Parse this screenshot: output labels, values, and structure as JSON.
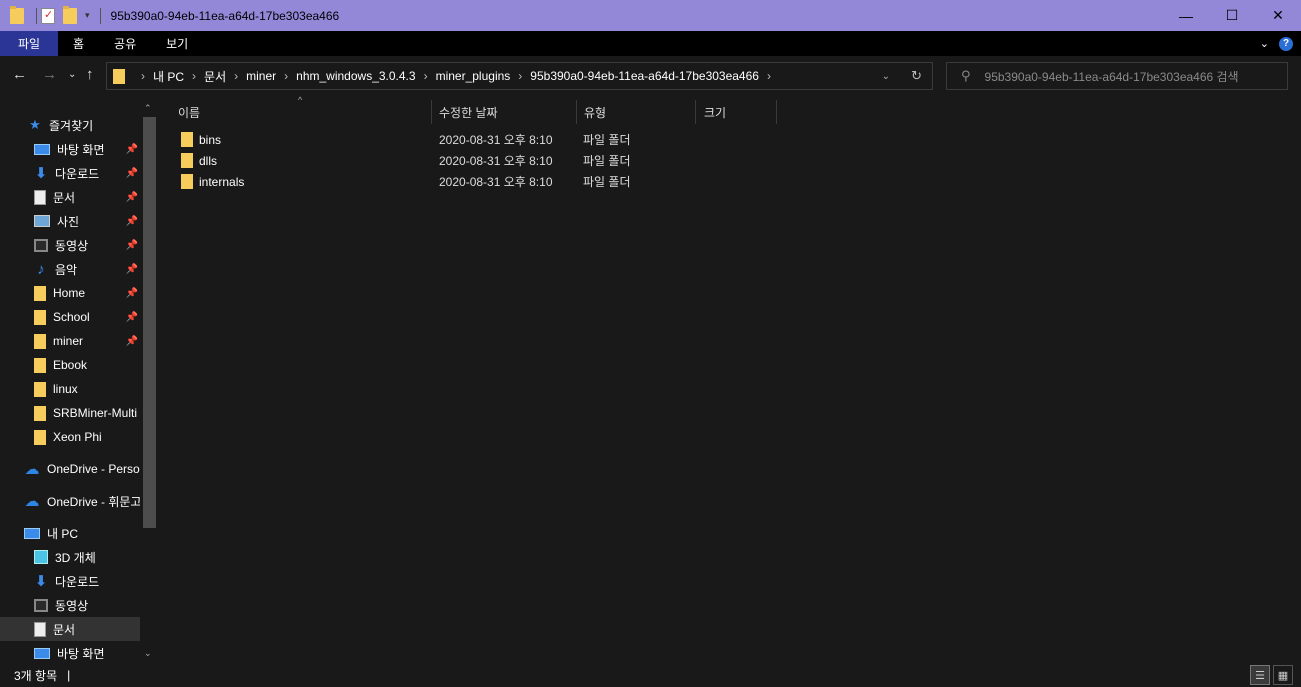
{
  "window": {
    "title": "95b390a0-94eb-11ea-a64d-17be303ea466",
    "minimize": "—",
    "maximize": "☐",
    "close": "✕"
  },
  "ribbon": {
    "tabs": [
      "파일",
      "홈",
      "공유",
      "보기"
    ],
    "expand_icon": "chevron-down-icon",
    "help": "?"
  },
  "address": {
    "crumbs": [
      "내 PC",
      "문서",
      "miner",
      "nhm_windows_3.0.4.3",
      "miner_plugins",
      "95b390a0-94eb-11ea-a64d-17be303ea466"
    ],
    "search_placeholder": "95b390a0-94eb-11ea-a64d-17be303ea466 검색"
  },
  "nav": {
    "quick_access": "즐겨찾기",
    "items": [
      {
        "label": "바탕 화면",
        "icon": "desktop-icon",
        "pinned": true
      },
      {
        "label": "다운로드",
        "icon": "download-icon",
        "pinned": true
      },
      {
        "label": "문서",
        "icon": "document-icon",
        "pinned": true
      },
      {
        "label": "사진",
        "icon": "pictures-icon",
        "pinned": true
      },
      {
        "label": "동영상",
        "icon": "videos-icon",
        "pinned": true
      },
      {
        "label": "음악",
        "icon": "music-icon",
        "pinned": true
      },
      {
        "label": "Home",
        "icon": "folder-icon",
        "pinned": true
      },
      {
        "label": "School",
        "icon": "folder-icon",
        "pinned": true
      },
      {
        "label": "miner",
        "icon": "folder-icon",
        "pinned": true
      },
      {
        "label": "Ebook",
        "icon": "folder-icon",
        "pinned": false
      },
      {
        "label": "linux",
        "icon": "folder-icon",
        "pinned": false
      },
      {
        "label": "SRBMiner-Multi",
        "icon": "folder-icon",
        "pinned": false
      },
      {
        "label": "Xeon Phi",
        "icon": "folder-icon",
        "pinned": false
      }
    ],
    "onedrive_personal": "OneDrive - Person",
    "onedrive_work": "OneDrive - 휘문고",
    "this_pc": "내 PC",
    "pc_items": [
      {
        "label": "3D 개체",
        "icon": "3d-objects-icon"
      },
      {
        "label": "다운로드",
        "icon": "download-icon"
      },
      {
        "label": "동영상",
        "icon": "videos-icon"
      },
      {
        "label": "문서",
        "icon": "document-icon"
      },
      {
        "label": "바탕 화면",
        "icon": "desktop-icon"
      }
    ]
  },
  "columns": {
    "name": "이름",
    "modified": "수정한 날짜",
    "type": "유형",
    "size": "크기"
  },
  "files": [
    {
      "name": "bins",
      "modified": "2020-08-31 오후 8:10",
      "type": "파일 폴더"
    },
    {
      "name": "dlls",
      "modified": "2020-08-31 오후 8:10",
      "type": "파일 폴더"
    },
    {
      "name": "internals",
      "modified": "2020-08-31 오후 8:10",
      "type": "파일 폴더"
    }
  ],
  "status": {
    "count": "3개 항목",
    "separator": "|"
  }
}
